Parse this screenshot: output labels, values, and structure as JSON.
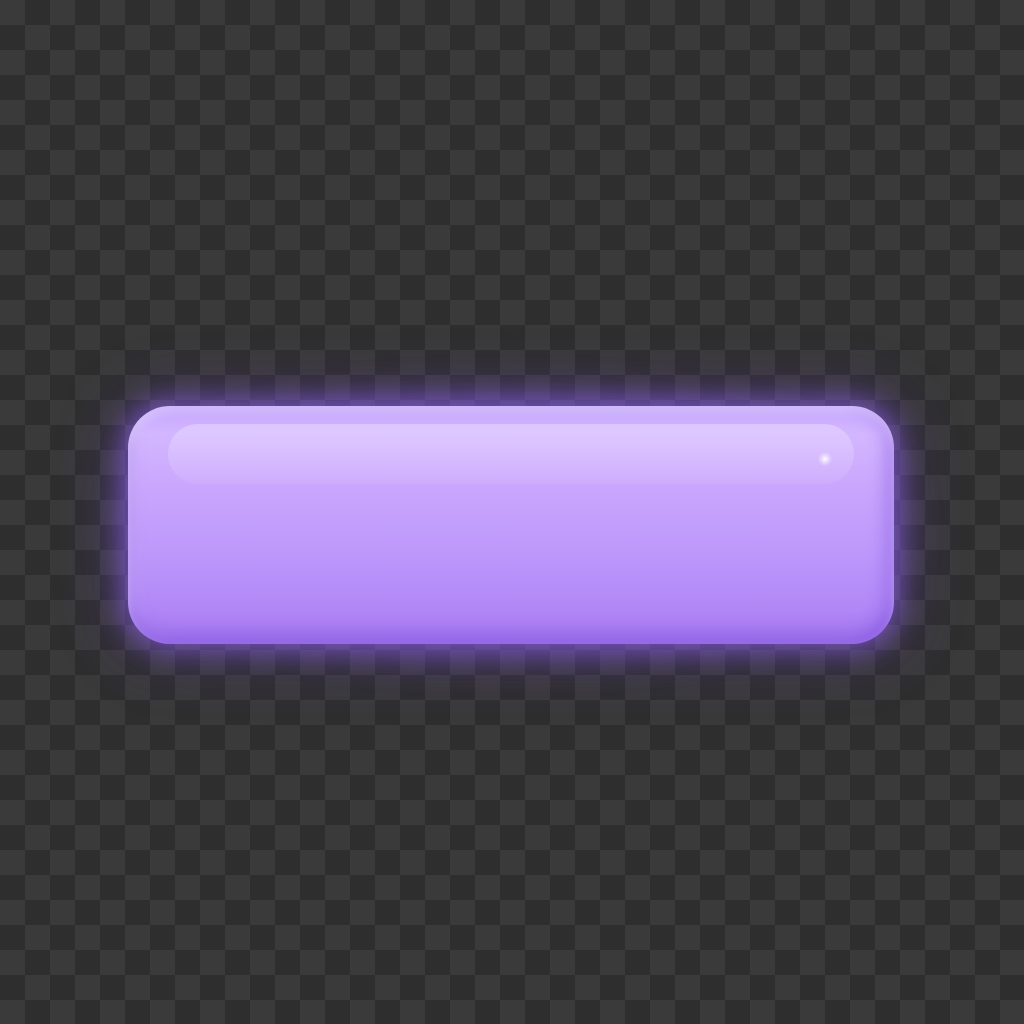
{
  "background": {
    "pattern": "transparency-checkerboard",
    "colors": [
      "#3a3a3a",
      "#2e2e2e"
    ]
  },
  "button": {
    "label": "",
    "shape": "rounded-rectangle",
    "colors": {
      "fill_top": "#d3b6ff",
      "fill_bottom": "#a67af0",
      "glow": "#9664ff"
    }
  }
}
